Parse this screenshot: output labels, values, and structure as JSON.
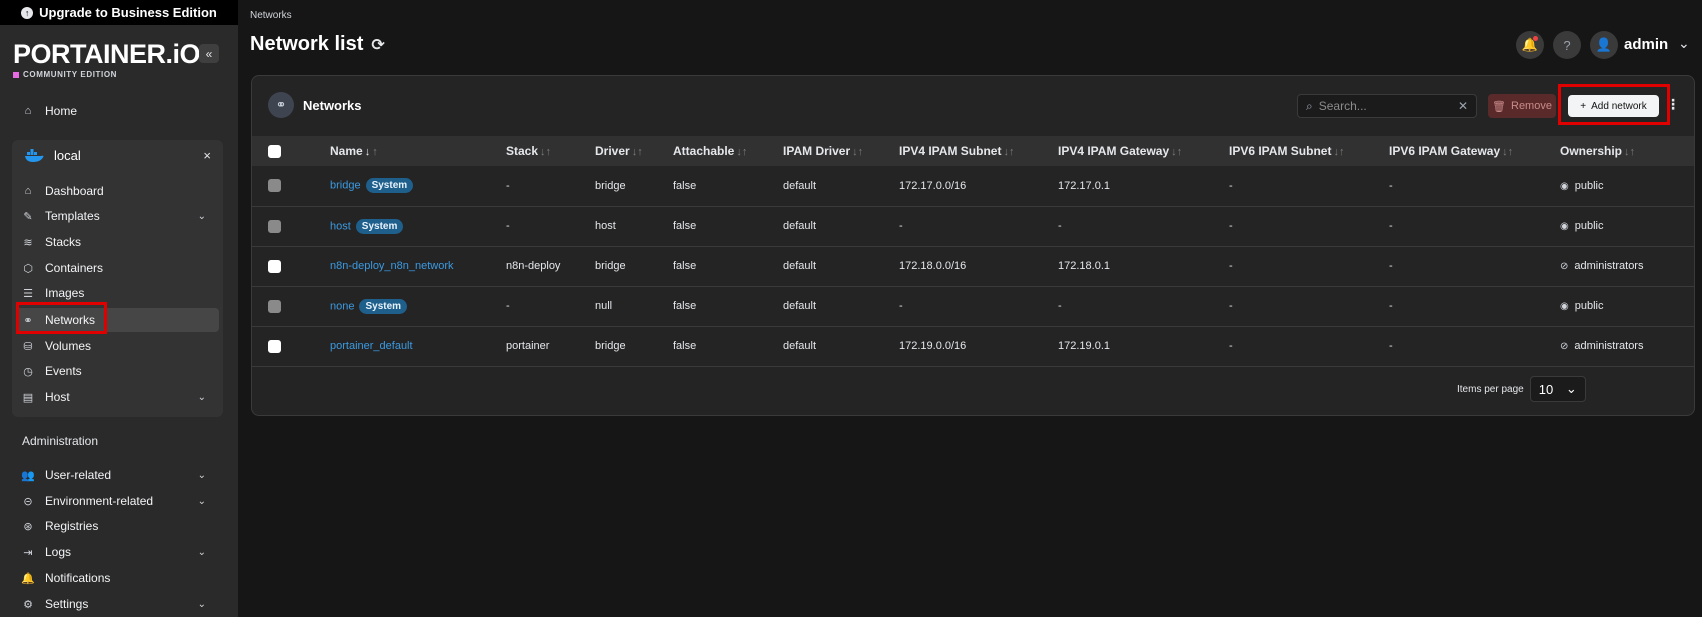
{
  "upgrade_banner": "Upgrade to Business Edition",
  "brand": {
    "logo": "PORTAINER.iO",
    "edition": "COMMUNITY EDITION",
    "accent": "#e86be4"
  },
  "sidebar": {
    "home": "Home",
    "environment": {
      "name": "local",
      "close": "×"
    },
    "env_items": [
      {
        "label": "Dashboard",
        "icon": "dashboard-icon"
      },
      {
        "label": "Templates",
        "icon": "templates-icon",
        "expandable": true
      },
      {
        "label": "Stacks",
        "icon": "stacks-icon"
      },
      {
        "label": "Containers",
        "icon": "containers-icon"
      },
      {
        "label": "Images",
        "icon": "images-icon"
      },
      {
        "label": "Networks",
        "icon": "networks-icon",
        "active": true
      },
      {
        "label": "Volumes",
        "icon": "volumes-icon"
      },
      {
        "label": "Events",
        "icon": "events-icon"
      },
      {
        "label": "Host",
        "icon": "host-icon",
        "expandable": true
      }
    ],
    "admin_heading": "Administration",
    "admin_items": [
      {
        "label": "User-related",
        "icon": "users-icon",
        "expandable": true
      },
      {
        "label": "Environment-related",
        "icon": "environment-icon",
        "expandable": true
      },
      {
        "label": "Registries",
        "icon": "registries-icon"
      },
      {
        "label": "Logs",
        "icon": "logs-icon",
        "expandable": true
      },
      {
        "label": "Notifications",
        "icon": "bell-icon"
      },
      {
        "label": "Settings",
        "icon": "settings-icon",
        "expandable": true
      }
    ]
  },
  "header": {
    "breadcrumb": "Networks",
    "title": "Network list",
    "user": "admin"
  },
  "panel": {
    "title": "Networks",
    "search_placeholder": "Search...",
    "remove_label": "Remove",
    "add_label": "Add network",
    "columns": [
      "Name",
      "Stack",
      "Driver",
      "Attachable",
      "IPAM Driver",
      "IPV4 IPAM Subnet",
      "IPV4 IPAM Gateway",
      "IPV6 IPAM Subnet",
      "IPV6 IPAM Gateway",
      "Ownership"
    ],
    "rows": [
      {
        "name": "bridge",
        "system": "System",
        "stack": "-",
        "driver": "bridge",
        "attachable": "false",
        "ipam_driver": "default",
        "ipv4_subnet": "172.17.0.0/16",
        "ipv4_gateway": "172.17.0.1",
        "ipv6_subnet": "-",
        "ipv6_gateway": "-",
        "ownership": "public",
        "checkbox": "grey"
      },
      {
        "name": "host",
        "system": "System",
        "stack": "-",
        "driver": "host",
        "attachable": "false",
        "ipam_driver": "default",
        "ipv4_subnet": "-",
        "ipv4_gateway": "-",
        "ipv6_subnet": "-",
        "ipv6_gateway": "-",
        "ownership": "public",
        "checkbox": "grey"
      },
      {
        "name": "n8n-deploy_n8n_network",
        "system": "",
        "stack": "n8n-deploy",
        "driver": "bridge",
        "attachable": "false",
        "ipam_driver": "default",
        "ipv4_subnet": "172.18.0.0/16",
        "ipv4_gateway": "172.18.0.1",
        "ipv6_subnet": "-",
        "ipv6_gateway": "-",
        "ownership": "administrators",
        "checkbox": "white"
      },
      {
        "name": "none",
        "system": "System",
        "stack": "-",
        "driver": "null",
        "attachable": "false",
        "ipam_driver": "default",
        "ipv4_subnet": "-",
        "ipv4_gateway": "-",
        "ipv6_subnet": "-",
        "ipv6_gateway": "-",
        "ownership": "public",
        "checkbox": "grey"
      },
      {
        "name": "portainer_default",
        "system": "",
        "stack": "portainer",
        "driver": "bridge",
        "attachable": "false",
        "ipam_driver": "default",
        "ipv4_subnet": "172.19.0.0/16",
        "ipv4_gateway": "172.19.0.1",
        "ipv6_subnet": "-",
        "ipv6_gateway": "-",
        "ownership": "administrators",
        "checkbox": "white"
      }
    ],
    "items_per_page_label": "Items per page",
    "items_per_page_value": "10"
  }
}
